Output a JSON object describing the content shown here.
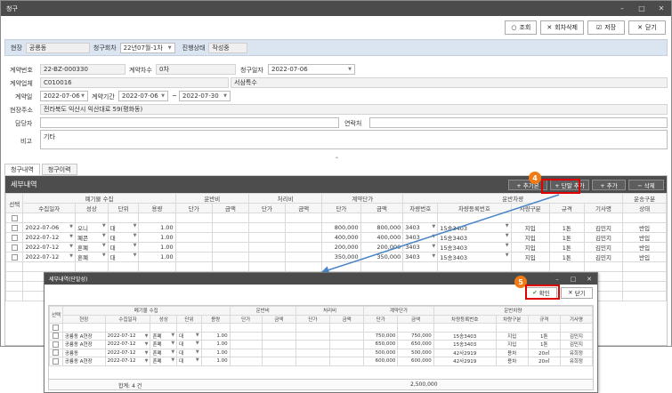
{
  "window": {
    "title": "청구",
    "min_icon": "minimize-icon",
    "max_icon": "maximize-icon",
    "close_icon": "close-icon"
  },
  "toolbar": {
    "search": "조회",
    "delete_round": "회차삭제",
    "save": "저장",
    "close": "닫기"
  },
  "filter": {
    "site_label": "현장",
    "site_value": "공룡동",
    "round_label": "청구회차",
    "round_value": "22년07월-1차",
    "status_label": "진행상태",
    "status_value": "작성중"
  },
  "form": {
    "contract_no_label": "계약번호",
    "contract_no": "22-BZ-000330",
    "contract_count_label": "계약차수",
    "contract_count": "0차",
    "claim_date_label": "청구일자",
    "claim_date": "2022-07-06",
    "company_label": "계약업체",
    "company_code": "C010016",
    "company_name": "서삼특수",
    "contract_date_label": "계약일",
    "contract_date": "2022-07-06",
    "period_label": "계약기간",
    "period_from": "2022-07-06",
    "period_tilde": "~",
    "period_to": "2022-07-30",
    "site_addr_label": "현장주소",
    "site_addr": "전라북도 익산시 익산대로 59(평화동)",
    "manager_label": "담당자",
    "contact_label": "연락처",
    "memo_label": "비고",
    "memo": "기타"
  },
  "tabs": [
    "청구내역",
    "청구이력"
  ],
  "grid": {
    "title": "세부내역",
    "buttons": {
      "add_basic": "+ 추기본",
      "add_unit": "+ 단말 추가",
      "add": "+ 추가",
      "delete": "− 삭제"
    },
    "groups": {
      "select": "선택",
      "waste": "폐기물 수집",
      "transport": "운반비",
      "treat": "처리비",
      "contract_price": "계약단가",
      "vehicle": "운반차량",
      "transport_type": "운송구분"
    },
    "columns": [
      "수집일자",
      "성상",
      "단위",
      "용량",
      "단가",
      "금액",
      "단가",
      "금액",
      "단가",
      "금액",
      "차량번호",
      "차량등록번호",
      "차량구분",
      "규격",
      "기사명",
      "상태"
    ],
    "rows": [
      [
        "2022-07-06",
        "오니",
        "대",
        "1.00",
        "",
        "",
        "",
        "",
        "800,000",
        "800,000",
        "3403",
        "15송3403",
        "지입",
        "1톤",
        "김민지",
        "반입"
      ],
      [
        "2022-07-12",
        "폐콘",
        "대",
        "1.00",
        "",
        "",
        "",
        "",
        "400,000",
        "400,000",
        "3403",
        "15송3403",
        "지입",
        "1톤",
        "김민지",
        "반입"
      ],
      [
        "2022-07-12",
        "혼폐",
        "대",
        "1.00",
        "",
        "",
        "",
        "",
        "200,000",
        "200,000",
        "3403",
        "15송3403",
        "지입",
        "1톤",
        "김민지",
        "반입"
      ],
      [
        "2022-07-12",
        "혼폐",
        "대",
        "1.00",
        "",
        "",
        "",
        "",
        "350,000",
        "350,000",
        "3403",
        "15송3403",
        "지입",
        "1톤",
        "김민지",
        "반입"
      ]
    ]
  },
  "badges": {
    "step4": "4",
    "step5": "5"
  },
  "popup": {
    "title": "세부내역(단말성)",
    "confirm": "확인",
    "close": "닫기",
    "groups": {
      "select": "선택",
      "waste": "폐기물 수집",
      "transport": "운반비",
      "treat": "처리비",
      "contract_price": "계약단가",
      "vehicle": "운반차량"
    },
    "columns": [
      "현장",
      "수집일자",
      "성상",
      "단위",
      "용량",
      "단가",
      "금액",
      "단가",
      "금액",
      "단가",
      "금액",
      "차량등록번호",
      "차량구분",
      "규격",
      "기사명"
    ],
    "rows": [
      [
        "공룡동 A현장",
        "2022-07-12",
        "혼폐",
        "대",
        "1.00",
        "",
        "",
        "",
        "",
        "750,000",
        "750,000",
        "15송3403",
        "지입",
        "1톤",
        "김민지"
      ],
      [
        "공룡동 A현장",
        "2022-07-12",
        "혼폐",
        "대",
        "1.00",
        "",
        "",
        "",
        "",
        "650,000",
        "650,000",
        "15송3403",
        "지입",
        "1톤",
        "김민지"
      ],
      [
        "공룡동",
        "2022-07-12",
        "혼폐",
        "대",
        "1.00",
        "",
        "",
        "",
        "",
        "500,000",
        "500,000",
        "42사2919",
        "용차",
        "20㎥",
        "유희정"
      ],
      [
        "공룡동 A현장",
        "2022-07-12",
        "혼폐",
        "대",
        "1.00",
        "",
        "",
        "",
        "",
        "600,000",
        "600,000",
        "42사2919",
        "용차",
        "20㎥",
        "유희정"
      ]
    ],
    "sum_label": "합계: 4 건",
    "sum_amount": "2,500,000"
  }
}
